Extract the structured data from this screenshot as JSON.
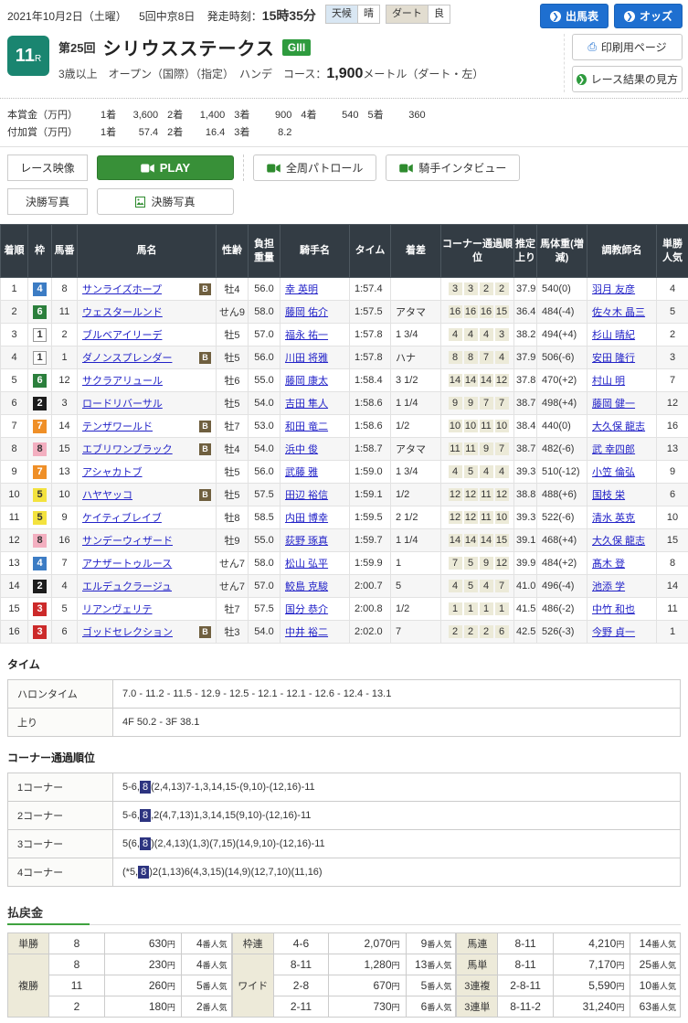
{
  "header": {
    "date_line": "2021年10月2日（土曜）",
    "meeting": "5回中京8日",
    "start_label": "発走時刻：",
    "start_time": "15時35分",
    "weather_label": "天候",
    "weather_value": "晴",
    "track_label": "ダート",
    "track_value": "良",
    "btn_entries": "出馬表",
    "btn_odds": "オッズ",
    "btn_print": "印刷用ページ",
    "btn_guide": "レース結果の見方"
  },
  "race": {
    "number": "11",
    "number_suffix": "R",
    "edition": "第25回",
    "title": "シリウスステークス",
    "grade": "GIII",
    "conditions": "3歳以上　オープン（国際）（指定）　ハンデ　コース：",
    "distance": "1,900",
    "distance_unit": "メートル（ダート・左）"
  },
  "prizes": {
    "main_label": "本賞金（万円）",
    "main": [
      [
        "1着",
        "3,600"
      ],
      [
        "2着",
        "1,400"
      ],
      [
        "3着",
        "900"
      ],
      [
        "4着",
        "540"
      ],
      [
        "5着",
        "360"
      ]
    ],
    "added_label": "付加賞（万円）",
    "added": [
      [
        "1着",
        "57.4"
      ],
      [
        "2着",
        "16.4"
      ],
      [
        "3着",
        "8.2"
      ]
    ]
  },
  "media": {
    "video_label": "レース映像",
    "play": "PLAY",
    "patrol": "全周パトロール",
    "interview": "騎手インタビュー",
    "photo_label": "決勝写真",
    "photo_button": "決勝写真"
  },
  "results": {
    "headers": {
      "pos": "着順",
      "frame": "枠",
      "num": "馬番",
      "horse": "馬名",
      "sexage": "性齢",
      "load": "負担重量",
      "jockey": "騎手名",
      "time": "タイム",
      "margin": "着差",
      "corner": "コーナー通過順位",
      "last3f": "推定上り",
      "body": "馬体重(増減)",
      "trainer": "調教師名",
      "fav": "単勝人気"
    },
    "rows": [
      {
        "pos": 1,
        "frame": 4,
        "num": 8,
        "horse": "サンライズホープ",
        "b": true,
        "sexage": "牡4",
        "load": "56.0",
        "jockey": "幸 英明",
        "time": "1:57.4",
        "margin": "",
        "corners": [
          "3",
          "3",
          "2",
          "2"
        ],
        "last3f": "37.9",
        "body": "540(0)",
        "trainer": "羽月 友彦",
        "fav": 4
      },
      {
        "pos": 2,
        "frame": 6,
        "num": 11,
        "horse": "ウェスタールンド",
        "b": false,
        "sexage": "せん9",
        "load": "58.0",
        "jockey": "藤岡 佑介",
        "time": "1:57.5",
        "margin": "アタマ",
        "corners": [
          "16",
          "16",
          "16",
          "15"
        ],
        "last3f": "36.4",
        "body": "484(-4)",
        "trainer": "佐々木 晶三",
        "fav": 5
      },
      {
        "pos": 3,
        "frame": 1,
        "num": 2,
        "horse": "ブルベアイリーデ",
        "b": false,
        "sexage": "牡5",
        "load": "57.0",
        "jockey": "福永 祐一",
        "time": "1:57.8",
        "margin": "1 3/4",
        "corners": [
          "4",
          "4",
          "4",
          "3"
        ],
        "last3f": "38.2",
        "body": "494(+4)",
        "trainer": "杉山 晴紀",
        "fav": 2
      },
      {
        "pos": 4,
        "frame": 1,
        "num": 1,
        "horse": "ダノンスプレンダー",
        "b": true,
        "sexage": "牡5",
        "load": "56.0",
        "jockey": "川田 将雅",
        "time": "1:57.8",
        "margin": "ハナ",
        "corners": [
          "8",
          "8",
          "7",
          "4"
        ],
        "last3f": "37.9",
        "body": "506(-6)",
        "trainer": "安田 隆行",
        "fav": 3
      },
      {
        "pos": 5,
        "frame": 6,
        "num": 12,
        "horse": "サクラアリュール",
        "b": false,
        "sexage": "牡6",
        "load": "55.0",
        "jockey": "藤岡 康太",
        "time": "1:58.4",
        "margin": "3 1/2",
        "corners": [
          "14",
          "14",
          "14",
          "12"
        ],
        "last3f": "37.8",
        "body": "470(+2)",
        "trainer": "村山 明",
        "fav": 7
      },
      {
        "pos": 6,
        "frame": 2,
        "num": 3,
        "horse": "ロードリバーサル",
        "b": false,
        "sexage": "牡5",
        "load": "54.0",
        "jockey": "吉田 隼人",
        "time": "1:58.6",
        "margin": "1 1/4",
        "corners": [
          "9",
          "9",
          "7",
          "7"
        ],
        "last3f": "38.7",
        "body": "498(+4)",
        "trainer": "藤岡 健一",
        "fav": 12
      },
      {
        "pos": 7,
        "frame": 7,
        "num": 14,
        "horse": "テンザワールド",
        "b": true,
        "sexage": "牡7",
        "load": "53.0",
        "jockey": "和田 竜二",
        "time": "1:58.6",
        "margin": "1/2",
        "corners": [
          "10",
          "10",
          "11",
          "10"
        ],
        "last3f": "38.4",
        "body": "440(0)",
        "trainer": "大久保 龍志",
        "fav": 16
      },
      {
        "pos": 8,
        "frame": 8,
        "num": 15,
        "horse": "エブリワンブラック",
        "b": true,
        "sexage": "牡4",
        "load": "54.0",
        "jockey": "浜中 俊",
        "time": "1:58.7",
        "margin": "アタマ",
        "corners": [
          "11",
          "11",
          "9",
          "7"
        ],
        "last3f": "38.7",
        "body": "482(-6)",
        "trainer": "武 幸四郎",
        "fav": 13
      },
      {
        "pos": 9,
        "frame": 7,
        "num": 13,
        "horse": "アシャカトブ",
        "b": false,
        "sexage": "牡5",
        "load": "56.0",
        "jockey": "武藤 雅",
        "time": "1:59.0",
        "margin": "1 3/4",
        "corners": [
          "4",
          "5",
          "4",
          "4"
        ],
        "last3f": "39.3",
        "body": "510(-12)",
        "trainer": "小笠 倫弘",
        "fav": 9
      },
      {
        "pos": 10,
        "frame": 5,
        "num": 10,
        "horse": "ハヤヤッコ",
        "b": true,
        "sexage": "牡5",
        "load": "57.5",
        "jockey": "田辺 裕信",
        "time": "1:59.1",
        "margin": "1/2",
        "corners": [
          "12",
          "12",
          "11",
          "12"
        ],
        "last3f": "38.8",
        "body": "488(+6)",
        "trainer": "国枝 栄",
        "fav": 6
      },
      {
        "pos": 11,
        "frame": 5,
        "num": 9,
        "horse": "ケイティブレイブ",
        "b": false,
        "sexage": "牡8",
        "load": "58.5",
        "jockey": "内田 博幸",
        "time": "1:59.5",
        "margin": "2 1/2",
        "corners": [
          "12",
          "12",
          "11",
          "10"
        ],
        "last3f": "39.3",
        "body": "522(-6)",
        "trainer": "清水 英克",
        "fav": 10
      },
      {
        "pos": 12,
        "frame": 8,
        "num": 16,
        "horse": "サンデーウィザード",
        "b": false,
        "sexage": "牡9",
        "load": "55.0",
        "jockey": "荻野 琢真",
        "time": "1:59.7",
        "margin": "1 1/4",
        "corners": [
          "14",
          "14",
          "14",
          "15"
        ],
        "last3f": "39.1",
        "body": "468(+4)",
        "trainer": "大久保 龍志",
        "fav": 15
      },
      {
        "pos": 13,
        "frame": 4,
        "num": 7,
        "horse": "アナザートゥルース",
        "b": false,
        "sexage": "せん7",
        "load": "58.0",
        "jockey": "松山 弘平",
        "time": "1:59.9",
        "margin": "1",
        "corners": [
          "7",
          "5",
          "9",
          "12"
        ],
        "last3f": "39.9",
        "body": "484(+2)",
        "trainer": "髙木 登",
        "fav": 8
      },
      {
        "pos": 14,
        "frame": 2,
        "num": 4,
        "horse": "エルデュクラージュ",
        "b": false,
        "sexage": "せん7",
        "load": "57.0",
        "jockey": "鮫島 克駿",
        "time": "2:00.7",
        "margin": "5",
        "corners": [
          "4",
          "5",
          "4",
          "7"
        ],
        "last3f": "41.0",
        "body": "496(-4)",
        "trainer": "池添 学",
        "fav": 14
      },
      {
        "pos": 15,
        "frame": 3,
        "num": 5,
        "horse": "リアンヴェリテ",
        "b": false,
        "sexage": "牡7",
        "load": "57.5",
        "jockey": "国分 恭介",
        "time": "2:00.8",
        "margin": "1/2",
        "corners": [
          "1",
          "1",
          "1",
          "1"
        ],
        "last3f": "41.5",
        "body": "486(-2)",
        "trainer": "中竹 和也",
        "fav": 11
      },
      {
        "pos": 16,
        "frame": 3,
        "num": 6,
        "horse": "ゴッドセレクション",
        "b": true,
        "sexage": "牡3",
        "load": "54.0",
        "jockey": "中井 裕二",
        "time": "2:02.0",
        "margin": "7",
        "corners": [
          "2",
          "2",
          "2",
          "6"
        ],
        "last3f": "42.5",
        "body": "526(-3)",
        "trainer": "今野 貞一",
        "fav": 1
      }
    ]
  },
  "time_section": {
    "heading": "タイム",
    "rows": [
      {
        "label": "ハロンタイム",
        "value": "7.0 - 11.2 - 11.5 - 12.9 - 12.5 - 12.1 - 12.1 - 12.6 - 12.4 - 13.1"
      },
      {
        "label": "上り",
        "value": "4F 50.2 - 3F 38.1"
      }
    ]
  },
  "corner_section": {
    "heading": "コーナー通過順位",
    "rows": [
      {
        "label": "1コーナー",
        "before": "5-6,",
        "highlight": "8",
        "after": "(2,4,13)7-1,3,14,15-(9,10)-(12,16)-11"
      },
      {
        "label": "2コーナー",
        "before": "5-6,",
        "highlight": "8",
        "after": ",2(4,7,13)1,3,14,15(9,10)-(12,16)-11"
      },
      {
        "label": "3コーナー",
        "before": "5(6,",
        "highlight": "8",
        "after": ")(2,4,13)(1,3)(7,15)(14,9,10)-(12,16)-11"
      },
      {
        "label": "4コーナー",
        "before": "(*5,",
        "highlight": "8",
        "after": ")2(1,13)6(4,3,15)(14,9)(12,7,10)(11,16)"
      }
    ]
  },
  "payout": {
    "heading": "払戻金",
    "unit": "円",
    "fav_suffix": "番人気",
    "columns": [
      [
        {
          "label": "単勝",
          "rows": [
            {
              "combo": "8",
              "amount": "630",
              "fav": "4"
            }
          ]
        },
        {
          "label": "複勝",
          "rows": [
            {
              "combo": "8",
              "amount": "230",
              "fav": "4"
            },
            {
              "combo": "11",
              "amount": "260",
              "fav": "5"
            },
            {
              "combo": "2",
              "amount": "180",
              "fav": "2"
            }
          ]
        }
      ],
      [
        {
          "label": "枠連",
          "rows": [
            {
              "combo": "4-6",
              "amount": "2,070",
              "fav": "9"
            }
          ]
        },
        {
          "label": "ワイド",
          "rows": [
            {
              "combo": "8-11",
              "amount": "1,280",
              "fav": "13"
            },
            {
              "combo": "2-8",
              "amount": "670",
              "fav": "5"
            },
            {
              "combo": "2-11",
              "amount": "730",
              "fav": "6"
            }
          ]
        }
      ],
      [
        {
          "label": "馬連",
          "rows": [
            {
              "combo": "8-11",
              "amount": "4,210",
              "fav": "14"
            }
          ]
        },
        {
          "label": "馬単",
          "rows": [
            {
              "combo": "8-11",
              "amount": "7,170",
              "fav": "25"
            }
          ]
        },
        {
          "label": "3連複",
          "rows": [
            {
              "combo": "2-8-11",
              "amount": "5,590",
              "fav": "10"
            }
          ]
        },
        {
          "label": "3連単",
          "rows": [
            {
              "combo": "8-11-2",
              "amount": "31,240",
              "fav": "63"
            }
          ]
        }
      ]
    ]
  }
}
